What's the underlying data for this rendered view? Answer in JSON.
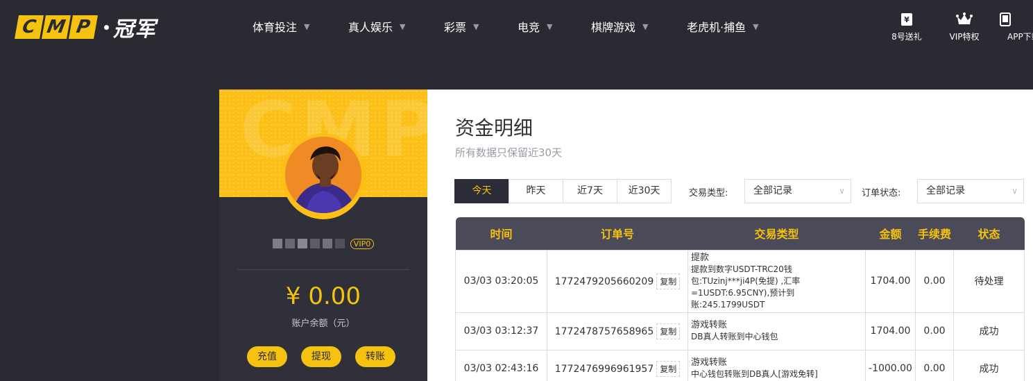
{
  "brand": {
    "logo_letters": [
      "C",
      "M",
      "P"
    ],
    "logo_cn": "冠军"
  },
  "nav": [
    {
      "label": "体育投注"
    },
    {
      "label": "真人娱乐"
    },
    {
      "label": "彩票"
    },
    {
      "label": "电竞"
    },
    {
      "label": "棋牌游戏"
    },
    {
      "label": "老虎机·捕鱼"
    }
  ],
  "top_icons": [
    {
      "icon": "gift-yen-icon",
      "label": "8号送礼"
    },
    {
      "icon": "crown-icon",
      "label": "VIP特权"
    },
    {
      "icon": "tablet-icon",
      "label": "APP下载"
    }
  ],
  "profile": {
    "hero_watermark": "CMP",
    "vip_label": "VIP0",
    "balance": "¥ 0.00",
    "balance_label": "账户余额（元）",
    "actions": [
      "充值",
      "提现",
      "转账"
    ]
  },
  "main": {
    "title": "资金明细",
    "subtitle": "所有数据只保留近30天",
    "tabs": [
      "今天",
      "昨天",
      "近7天",
      "近30天"
    ],
    "active_tab": "今天",
    "filters": {
      "type_label": "交易类型:",
      "type_value": "全部记录",
      "status_label": "订单状态:",
      "status_value": "全部记录"
    },
    "table": {
      "headers": [
        "时间",
        "订单号",
        "交易类型",
        "金额",
        "手续费",
        "状态"
      ],
      "copy_label": "复制",
      "rows": [
        {
          "time": "03/03 03:20:05",
          "order": "1772479205660209",
          "type_title": "提款",
          "type_desc": "提款到数字USDT-TRC20钱包:TUzinj***ji4P(免提) ,汇率=1USDT:6.95CNY),预计到账:245.1799USDT",
          "amount": "1704.00",
          "fee": "0.00",
          "status": "待处理"
        },
        {
          "time": "03/03 03:12:37",
          "order": "1772478757658965",
          "type_title": "游戏转账",
          "type_desc": "DB真人转账到中心钱包",
          "amount": "1704.00",
          "fee": "0.00",
          "status": "成功"
        },
        {
          "time": "03/03 02:43:16",
          "order": "1772476996961957",
          "type_title": "游戏转账",
          "type_desc": "中心钱包转账到DB真人[游戏免转]",
          "amount": "-1000.00",
          "fee": "0.00",
          "status": "成功"
        }
      ]
    }
  },
  "colors": {
    "accent": "#f5c20f",
    "dark": "#2a2a33",
    "success": "#2e9c3a"
  }
}
